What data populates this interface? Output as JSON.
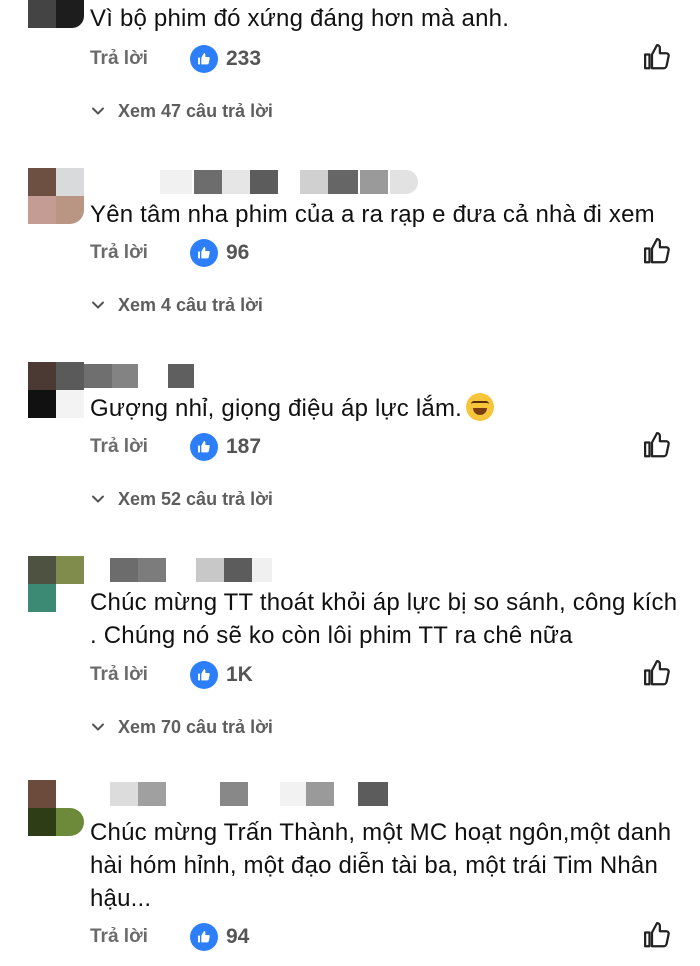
{
  "comments": [
    {
      "text": "Vì bộ phim đó xứng đáng hơn mà anh.",
      "reply_label": "Trả lời",
      "likes": "233",
      "view_replies": "Xem 47 câu trả lời"
    },
    {
      "text": "Yên tâm nha phim của a ra rạp e đưa cả nhà đi xem",
      "reply_label": "Trả lời",
      "likes": "96",
      "view_replies": "Xem 4 câu trả lời"
    },
    {
      "text": "Gượng nhỉ, giọng điệu áp lực lắm.",
      "reply_label": "Trả lời",
      "likes": "187",
      "view_replies": "Xem 52 câu trả lời"
    },
    {
      "text": "Chúc mừng TT thoát khỏi áp lực bị so sánh, công kích . Chúng nó sẽ ko còn lôi phim TT ra chê nữa",
      "reply_label": "Trả lời",
      "likes": "1K",
      "view_replies": "Xem 70 câu trả lời"
    },
    {
      "text": "Chúc mừng Trấn Thành, một MC hoạt ngôn,một danh hài hóm hỉnh, một đạo diễn tài ba, một trái Tim Nhân hậu...",
      "reply_label": "Trả lời",
      "likes": "94"
    }
  ],
  "icons": {
    "like_badge": "thumbs-up-icon",
    "like_button": "thumbs-up-outline-icon",
    "expand": "chevron-down-icon",
    "emoji": "rolling-on-floor-laughing-emoji"
  },
  "colors": {
    "like_blue": "#2d7ff9",
    "secondary_text": "#6b6b6b"
  }
}
